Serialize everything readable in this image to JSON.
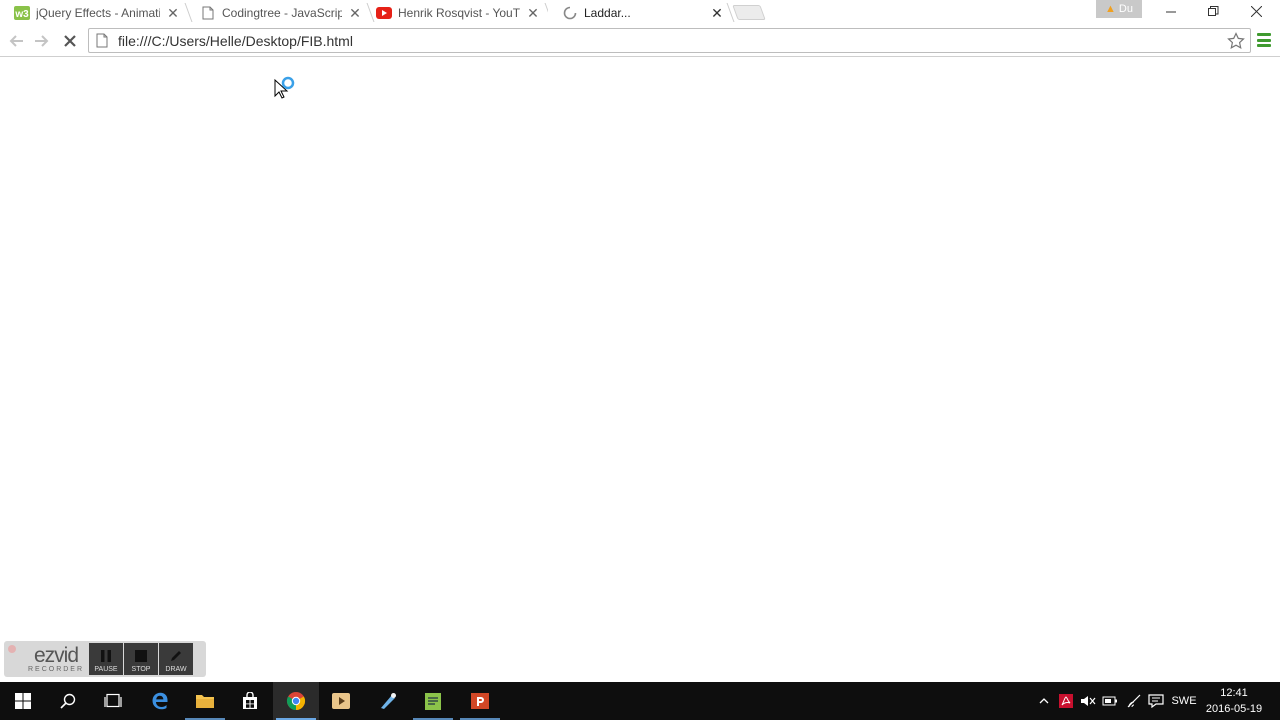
{
  "tabs": [
    {
      "title": "jQuery Effects - Animation",
      "icon": "w3schools-icon"
    },
    {
      "title": "Codingtree - JavaScript and",
      "icon": "document-icon"
    },
    {
      "title": "Henrik Rosqvist - YouTube",
      "icon": "youtube-icon"
    },
    {
      "title": "Laddar...",
      "icon": "loading-spinner-icon"
    }
  ],
  "profile_badge": "Du",
  "address_bar": {
    "url": "file:///C:/Users/Helle/Desktop/FIB.html"
  },
  "ezvid": {
    "brand": "ezvid",
    "sub": "RECORDER",
    "buttons": [
      "PAUSE",
      "STOP",
      "DRAW"
    ]
  },
  "taskbar": {
    "language": "SWE",
    "time": "12:41",
    "date": "2016-05-19"
  },
  "colors": {
    "accent_green": "#3f9a2f",
    "taskbar": "#0e0e0e",
    "youtube_red": "#e62117",
    "taskbar_indicator": "#6aa7e4"
  }
}
